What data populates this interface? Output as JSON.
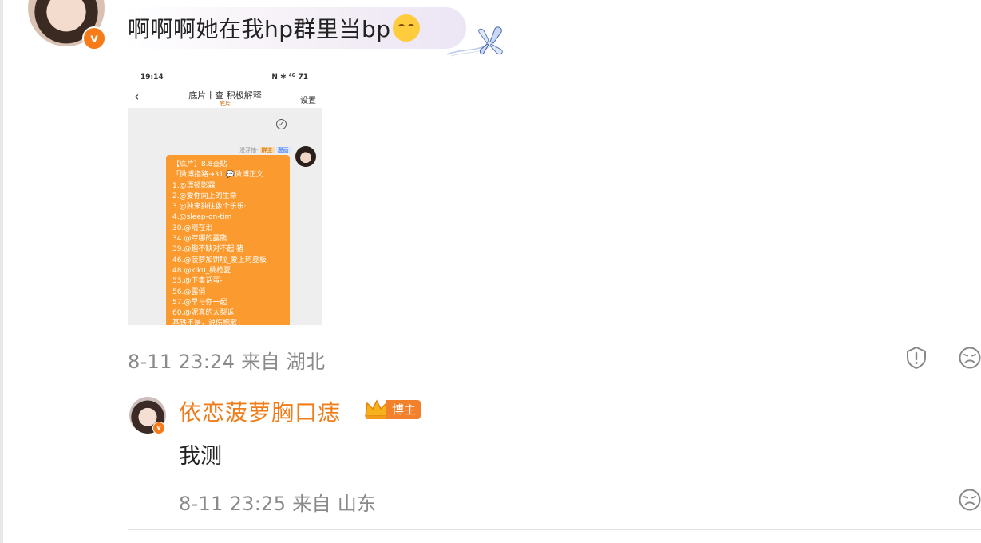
{
  "comment": {
    "text": "啊啊啊她在我hp群里当bp",
    "emoji_icon": "pleading-face-emoji",
    "decoration": "butterfly",
    "timestamp": "8-11 23:24",
    "location_prefix": "来自",
    "location": "湖北"
  },
  "screenshot": {
    "time": "19:14",
    "status_icons": "N ✱ ⁴ᴳ 71",
    "title": "底片丨查 积极解释",
    "subtitle": "底片",
    "settings_label": "设置",
    "sender_name": "漫浮柚-",
    "sender_tag1": "群主",
    "sender_tag2": "漫画",
    "message_lines": [
      "【底片】8.8查贴",
      "「微博指路→31.💬微博正文",
      "1.@漂顿影霖",
      "2.@爱你向上的生命",
      "3.@独来独往像个乐乐·",
      "4.@sleep-on-tim",
      "30.@晴在泪",
      "34.@哼哪的露熊",
      "39.@趣不缺对不起·猪",
      "46.@菠萝加饼啦_爱上珂夏板",
      "48.@kiku_桃枪夏",
      "53.@下卖话蛋-",
      "56.@露俏",
      "57.@早与你一起",
      "60.@泥真的太梨诉",
      "基铁不是，说伤抱歉」"
    ]
  },
  "reply": {
    "author": "依恋菠萝胸口痣",
    "badge": "博主",
    "text": "我测",
    "timestamp": "8-11 23:25",
    "location_prefix": "来自",
    "location": "山东"
  },
  "colors": {
    "accent_orange": "#f07c1a",
    "meta_gray": "#8a8a8a",
    "bubble_tint": "#ece5f5"
  }
}
